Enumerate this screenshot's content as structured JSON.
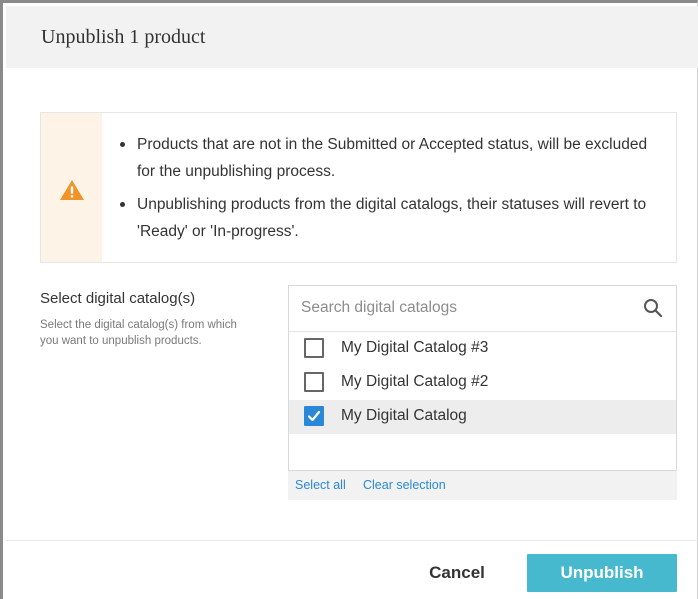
{
  "dialog": {
    "title": "Unpublish 1 product"
  },
  "alert": {
    "icon": "warning-icon",
    "icon_color": "#f0942a",
    "messages": [
      "Products that are not in the Submitted or Accepted status, will be excluded for the unpublishing process.",
      "Unpublishing products from the digital catalogs, their statuses will revert to 'Ready' or 'In-progress'."
    ]
  },
  "catalog_field": {
    "label": "Select digital catalog(s)",
    "help": "Select the digital catalog(s) from which you want to unpublish products.",
    "search_placeholder": "Search digital catalogs",
    "search_value": "",
    "options": [
      {
        "label": "My Digital Catalog #3",
        "checked": false
      },
      {
        "label": "My Digital Catalog #2",
        "checked": false
      },
      {
        "label": "My Digital Catalog",
        "checked": true
      }
    ],
    "select_all_label": "Select all",
    "clear_selection_label": "Clear selection"
  },
  "footer": {
    "cancel_label": "Cancel",
    "primary_label": "Unpublish"
  },
  "colors": {
    "accent": "#2b88d8",
    "primary_button": "#46b9cf",
    "warning": "#f0942a"
  }
}
